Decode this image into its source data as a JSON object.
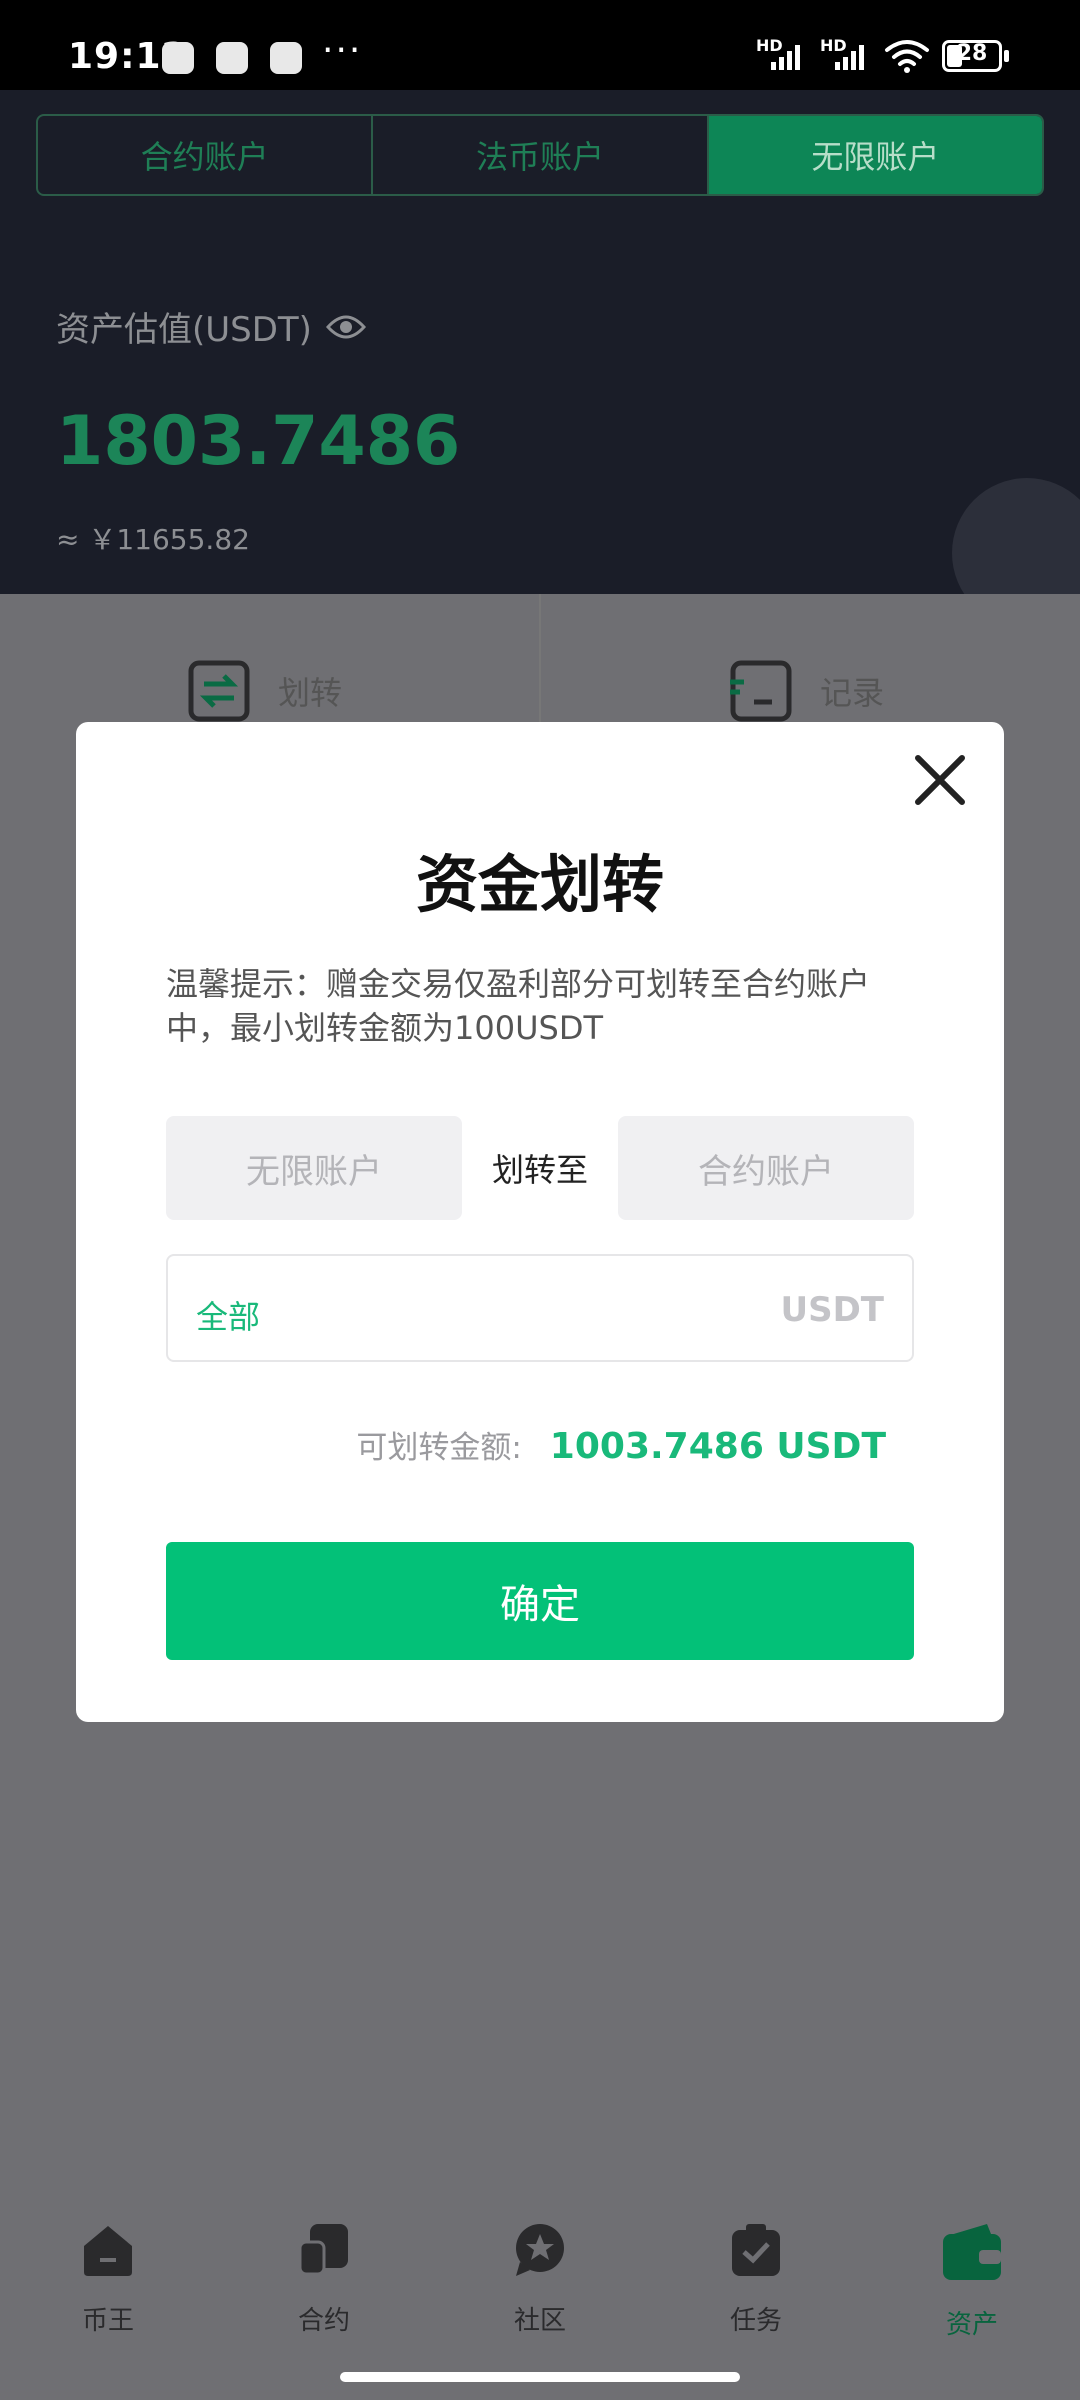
{
  "status_bar": {
    "time": "19:12",
    "dots": "···",
    "hd1": "HD",
    "hd2": "HD",
    "battery": "28",
    "icons": [
      "app-notification-icon",
      "game-notification-icon",
      "alipay-notification-icon",
      "signal-icon",
      "wifi-icon",
      "battery-icon"
    ]
  },
  "header": {
    "tabs": [
      {
        "label": "合约账户",
        "active": false
      },
      {
        "label": "法币账户",
        "active": false
      },
      {
        "label": "无限账户",
        "active": true
      }
    ],
    "asset_label": "资产估值(USDT)",
    "asset_value": "1803.7486",
    "asset_cny": "≈ ￥11655.82"
  },
  "actions": {
    "transfer": "划转",
    "records": "记录"
  },
  "modal": {
    "title": "资金划转",
    "tip": "温馨提示：赠金交易仅盈利部分可划转至合约账户中，最小划转金额为100USDT",
    "from_account": "无限账户",
    "transfer_to": "划转至",
    "to_account": "合约账户",
    "all_label": "全部",
    "unit": "USDT",
    "available_label": "可划转金额:",
    "available_value": "1003.7486 USDT",
    "confirm": "确定"
  },
  "bottom_nav": {
    "items": [
      {
        "label": "币王",
        "icon": "home-icon",
        "active": false
      },
      {
        "label": "合约",
        "icon": "contract-icon",
        "active": false
      },
      {
        "label": "社区",
        "icon": "community-icon",
        "active": false
      },
      {
        "label": "任务",
        "icon": "task-icon",
        "active": false
      },
      {
        "label": "资产",
        "icon": "wallet-icon",
        "active": true
      }
    ]
  },
  "colors": {
    "accent": "#03c178",
    "header_bg": "#1a1d28",
    "overlay": "#6f6f73"
  }
}
